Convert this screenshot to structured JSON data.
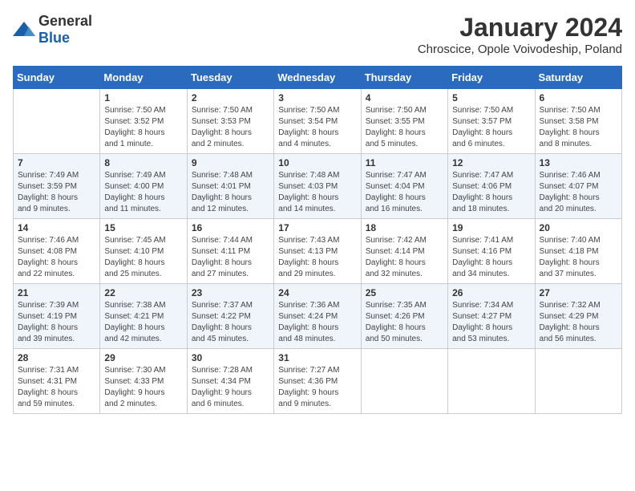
{
  "logo": {
    "general": "General",
    "blue": "Blue"
  },
  "title": "January 2024",
  "subtitle": "Chroscice, Opole Voivodeship, Poland",
  "headers": [
    "Sunday",
    "Monday",
    "Tuesday",
    "Wednesday",
    "Thursday",
    "Friday",
    "Saturday"
  ],
  "weeks": [
    [
      {
        "day": "",
        "info": ""
      },
      {
        "day": "1",
        "info": "Sunrise: 7:50 AM\nSunset: 3:52 PM\nDaylight: 8 hours\nand 1 minute."
      },
      {
        "day": "2",
        "info": "Sunrise: 7:50 AM\nSunset: 3:53 PM\nDaylight: 8 hours\nand 2 minutes."
      },
      {
        "day": "3",
        "info": "Sunrise: 7:50 AM\nSunset: 3:54 PM\nDaylight: 8 hours\nand 4 minutes."
      },
      {
        "day": "4",
        "info": "Sunrise: 7:50 AM\nSunset: 3:55 PM\nDaylight: 8 hours\nand 5 minutes."
      },
      {
        "day": "5",
        "info": "Sunrise: 7:50 AM\nSunset: 3:57 PM\nDaylight: 8 hours\nand 6 minutes."
      },
      {
        "day": "6",
        "info": "Sunrise: 7:50 AM\nSunset: 3:58 PM\nDaylight: 8 hours\nand 8 minutes."
      }
    ],
    [
      {
        "day": "7",
        "info": "Sunrise: 7:49 AM\nSunset: 3:59 PM\nDaylight: 8 hours\nand 9 minutes."
      },
      {
        "day": "8",
        "info": "Sunrise: 7:49 AM\nSunset: 4:00 PM\nDaylight: 8 hours\nand 11 minutes."
      },
      {
        "day": "9",
        "info": "Sunrise: 7:48 AM\nSunset: 4:01 PM\nDaylight: 8 hours\nand 12 minutes."
      },
      {
        "day": "10",
        "info": "Sunrise: 7:48 AM\nSunset: 4:03 PM\nDaylight: 8 hours\nand 14 minutes."
      },
      {
        "day": "11",
        "info": "Sunrise: 7:47 AM\nSunset: 4:04 PM\nDaylight: 8 hours\nand 16 minutes."
      },
      {
        "day": "12",
        "info": "Sunrise: 7:47 AM\nSunset: 4:06 PM\nDaylight: 8 hours\nand 18 minutes."
      },
      {
        "day": "13",
        "info": "Sunrise: 7:46 AM\nSunset: 4:07 PM\nDaylight: 8 hours\nand 20 minutes."
      }
    ],
    [
      {
        "day": "14",
        "info": "Sunrise: 7:46 AM\nSunset: 4:08 PM\nDaylight: 8 hours\nand 22 minutes."
      },
      {
        "day": "15",
        "info": "Sunrise: 7:45 AM\nSunset: 4:10 PM\nDaylight: 8 hours\nand 25 minutes."
      },
      {
        "day": "16",
        "info": "Sunrise: 7:44 AM\nSunset: 4:11 PM\nDaylight: 8 hours\nand 27 minutes."
      },
      {
        "day": "17",
        "info": "Sunrise: 7:43 AM\nSunset: 4:13 PM\nDaylight: 8 hours\nand 29 minutes."
      },
      {
        "day": "18",
        "info": "Sunrise: 7:42 AM\nSunset: 4:14 PM\nDaylight: 8 hours\nand 32 minutes."
      },
      {
        "day": "19",
        "info": "Sunrise: 7:41 AM\nSunset: 4:16 PM\nDaylight: 8 hours\nand 34 minutes."
      },
      {
        "day": "20",
        "info": "Sunrise: 7:40 AM\nSunset: 4:18 PM\nDaylight: 8 hours\nand 37 minutes."
      }
    ],
    [
      {
        "day": "21",
        "info": "Sunrise: 7:39 AM\nSunset: 4:19 PM\nDaylight: 8 hours\nand 39 minutes."
      },
      {
        "day": "22",
        "info": "Sunrise: 7:38 AM\nSunset: 4:21 PM\nDaylight: 8 hours\nand 42 minutes."
      },
      {
        "day": "23",
        "info": "Sunrise: 7:37 AM\nSunset: 4:22 PM\nDaylight: 8 hours\nand 45 minutes."
      },
      {
        "day": "24",
        "info": "Sunrise: 7:36 AM\nSunset: 4:24 PM\nDaylight: 8 hours\nand 48 minutes."
      },
      {
        "day": "25",
        "info": "Sunrise: 7:35 AM\nSunset: 4:26 PM\nDaylight: 8 hours\nand 50 minutes."
      },
      {
        "day": "26",
        "info": "Sunrise: 7:34 AM\nSunset: 4:27 PM\nDaylight: 8 hours\nand 53 minutes."
      },
      {
        "day": "27",
        "info": "Sunrise: 7:32 AM\nSunset: 4:29 PM\nDaylight: 8 hours\nand 56 minutes."
      }
    ],
    [
      {
        "day": "28",
        "info": "Sunrise: 7:31 AM\nSunset: 4:31 PM\nDaylight: 8 hours\nand 59 minutes."
      },
      {
        "day": "29",
        "info": "Sunrise: 7:30 AM\nSunset: 4:33 PM\nDaylight: 9 hours\nand 2 minutes."
      },
      {
        "day": "30",
        "info": "Sunrise: 7:28 AM\nSunset: 4:34 PM\nDaylight: 9 hours\nand 6 minutes."
      },
      {
        "day": "31",
        "info": "Sunrise: 7:27 AM\nSunset: 4:36 PM\nDaylight: 9 hours\nand 9 minutes."
      },
      {
        "day": "",
        "info": ""
      },
      {
        "day": "",
        "info": ""
      },
      {
        "day": "",
        "info": ""
      }
    ]
  ]
}
